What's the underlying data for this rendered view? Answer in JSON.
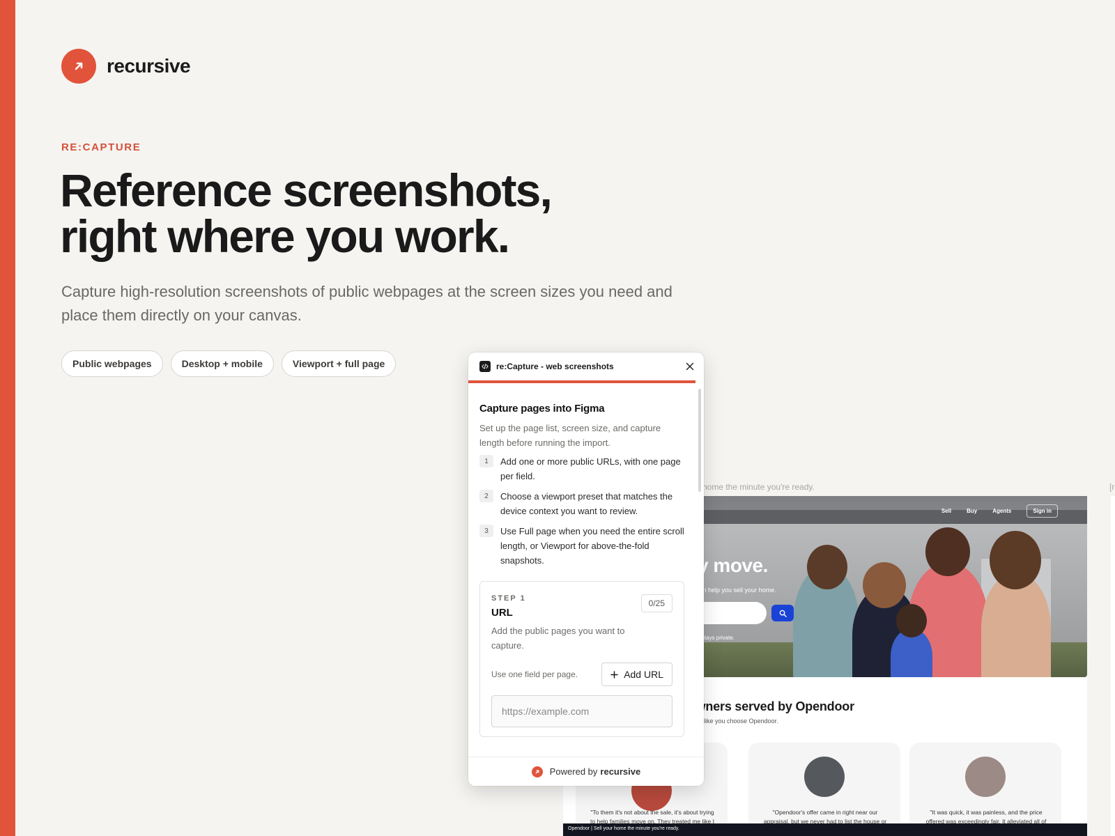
{
  "brand": {
    "name": "recursive",
    "icon": "arrow-up-right-icon",
    "accent_color": "#e1533a"
  },
  "hero": {
    "eyebrow": "RE:CAPTURE",
    "headline_line1": "Reference screenshots,",
    "headline_line2": "right where you work.",
    "subhead": "Capture high-resolution screenshots of public webpages at the screen sizes you need and place them directly on your canvas.",
    "pills": [
      "Public webpages",
      "Desktop + mobile",
      "Viewport + full page"
    ]
  },
  "preview": {
    "caption": "home the minute you're ready.",
    "caption_right": "[r",
    "nav": [
      "Sell",
      "Buy",
      "Agents",
      "Sign in"
    ],
    "hero_title": "sy move.",
    "hero_sub": "s we can help you sell your home.",
    "hero_private": "rmation stays private.",
    "served_title": "eowners served by Opendoor",
    "served_sub": "like you choose Opendoor.",
    "quotes": [
      "\"To them it's not about the sale, it's about trying to help families move on. They treated me like I",
      "\"Opendoor's offer came in right near our appraisal, but we never had to list the house or",
      "\"It was quick, it was painless, and the price offered was exceedingly fair. It alleviated all of"
    ],
    "footer": "Opendoor | Sell your home the minute you're ready."
  },
  "panel": {
    "title": "re:Capture - web screenshots",
    "heading": "Capture pages into Figma",
    "description": "Set up the page list, screen size, and capture length before running the import.",
    "steps": [
      {
        "num": "1",
        "text": "Add one or more public URLs, with one page per field."
      },
      {
        "num": "2",
        "text": "Choose a viewport preset that matches the device context you want to review."
      },
      {
        "num": "3",
        "text": "Use Full page when you need the entire scroll length, or Viewport for above-the-fold snapshots."
      }
    ],
    "card": {
      "step_label": "STEP 1",
      "title": "URL",
      "counter": "0/25",
      "description": "Add the public pages you want to capture.",
      "hint": "Use one field per page.",
      "add_url_label": "Add URL",
      "url_placeholder": "https://example.com",
      "url_value": ""
    },
    "footer_prefix": "Powered by",
    "footer_brand": "recursive"
  }
}
